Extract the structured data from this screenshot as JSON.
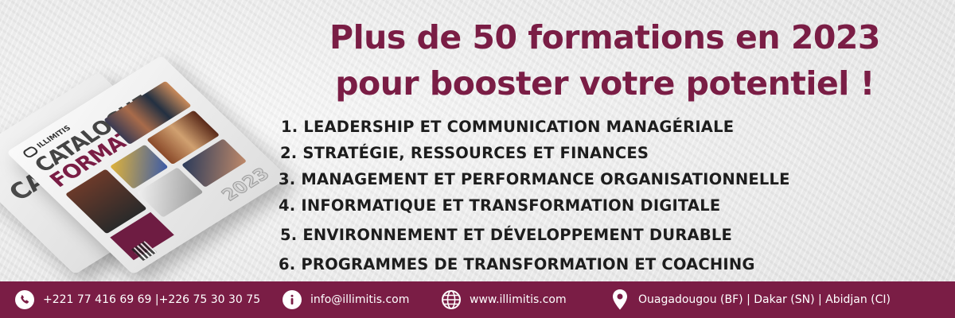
{
  "magazine": {
    "logo_text": "ILLIMITIS",
    "title_line_1": "CATALOGUE",
    "title_line_2": "FORMATION",
    "year": "2023",
    "back_cover_word": "CA"
  },
  "headline": {
    "line_1": "Plus de 50 formations en 2023",
    "line_2": "pour booster votre potentiel !"
  },
  "programmes": [
    "1. LEADERSHIP ET COMMUNICATION MANAGÉRIALE",
    "2. STRATÉGIE, RESSOURCES ET FINANCES",
    "3. MANAGEMENT ET PERFORMANCE ORGANISATIONNELLE",
    "4. INFORMATIQUE ET TRANSFORMATION DIGITALE",
    "5. ENVIRONNEMENT ET DÉVELOPPEMENT DURABLE",
    "6. PROGRAMMES DE TRANSFORMATION ET COACHING"
  ],
  "footer": {
    "phone": "+221 77 416 69 69 |+226 75 30 30 75",
    "email": "info@illimitis.com",
    "website": "www.illimitis.com",
    "locations": "Ouagadougou (BF) | Dakar (SN) | Abidjan (CI)"
  },
  "colors": {
    "brand": "#7a1d45",
    "text_dark": "#1d1d1d",
    "footer_text": "#ffffff"
  },
  "icons": {
    "phone": "phone-icon",
    "email": "info-icon",
    "website": "globe-icon",
    "location": "map-pin-icon"
  }
}
